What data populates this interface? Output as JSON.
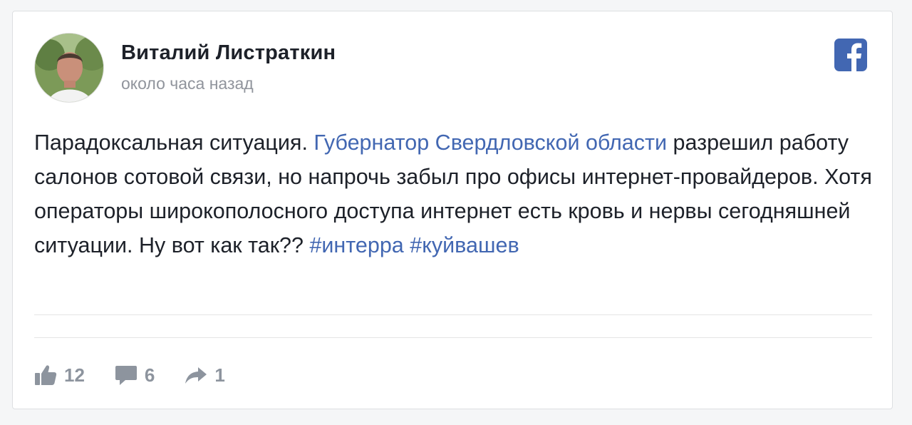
{
  "post": {
    "author": "Виталий Листраткин",
    "timestamp": "около часа назад",
    "text_before_link": "Парадоксальная ситуация. ",
    "link_text": "Губернатор Свердловской области",
    "text_after_link": " разрешил работу салонов сотовой связи, но напрочь забыл про офисы интернет-провайдеров. Хотя операторы широкополосного доступа интернет есть кровь и нервы сегодняшней ситуации. Ну вот как так?? ",
    "hashtags": [
      "#интерра",
      "#куйвашев"
    ]
  },
  "stats": {
    "likes": "12",
    "comments": "6",
    "shares": "1"
  },
  "icons": {
    "source": "facebook-icon",
    "like": "thumbs-up-icon",
    "comment": "comment-icon",
    "share": "share-arrow-icon"
  },
  "colors": {
    "facebook_blue": "#4267b2",
    "link": "#4267b2",
    "muted": "#8d949e"
  }
}
